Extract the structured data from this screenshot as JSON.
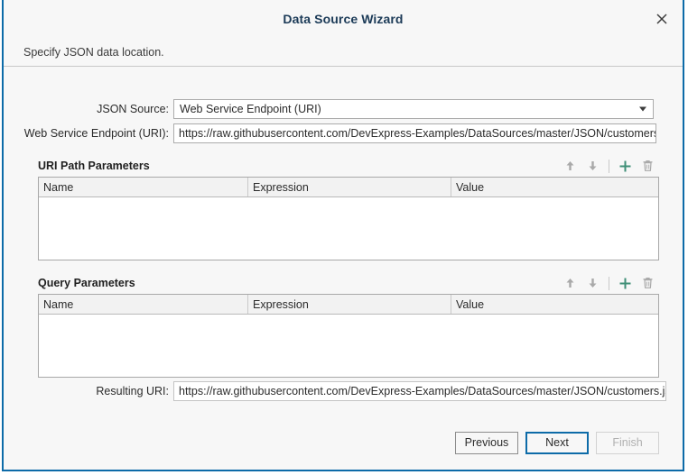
{
  "window": {
    "title": "Data Source Wizard",
    "close_icon": "close-icon",
    "description": "Specify JSON data location."
  },
  "form": {
    "json_source": {
      "label": "JSON Source:",
      "value": "Web Service Endpoint (URI)",
      "arrow_icon": "chevron-down-icon"
    },
    "endpoint": {
      "label": "Web Service Endpoint (URI):",
      "value": "https://raw.githubusercontent.com/DevExpress-Examples/DataSources/master/JSON/customers.json"
    },
    "resulting_uri": {
      "label": "Resulting URI:",
      "value": "https://raw.githubusercontent.com/DevExpress-Examples/DataSources/master/JSON/customers.json"
    }
  },
  "sections": [
    {
      "title": "URI Path Parameters",
      "tools": [
        {
          "name": "move-up-icon",
          "glyph": "arrow-up"
        },
        {
          "name": "move-down-icon",
          "glyph": "arrow-down"
        },
        {
          "name": "add-icon",
          "glyph": "plus"
        },
        {
          "name": "delete-icon",
          "glyph": "trash"
        }
      ],
      "columns": [
        "Name",
        "Expression",
        "Value"
      ],
      "rows": []
    },
    {
      "title": "Query Parameters",
      "tools": [
        {
          "name": "move-up-icon",
          "glyph": "arrow-up"
        },
        {
          "name": "move-down-icon",
          "glyph": "arrow-down"
        },
        {
          "name": "add-icon",
          "glyph": "plus"
        },
        {
          "name": "delete-icon",
          "glyph": "trash"
        }
      ],
      "columns": [
        "Name",
        "Expression",
        "Value"
      ],
      "rows": []
    }
  ],
  "footer": {
    "previous_label": "Previous",
    "next_label": "Next",
    "finish_label": "Finish"
  },
  "colors": {
    "dialog_border": "#0d6ba8",
    "title_text": "#1b3a57",
    "accent_add": "#3f8f77",
    "icon_gray": "#9a9a9a",
    "background": "#f7f7f7"
  }
}
